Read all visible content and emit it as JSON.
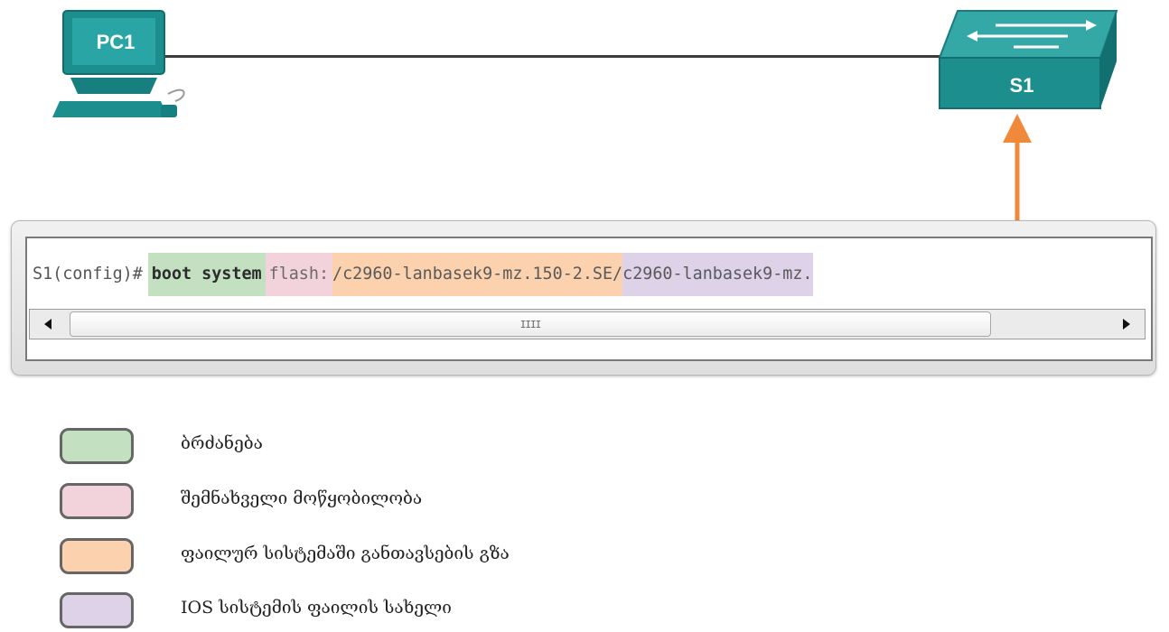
{
  "topology": {
    "pc_label": "PC1",
    "switch_label": "S1"
  },
  "terminal": {
    "prompt": "S1(config)#",
    "command": "boot system",
    "device": "flash:",
    "path": "/c2960-lanbasek9-mz.150-2.SE/",
    "filename": "c2960-lanbasek9-mz.",
    "scroll_thumb_glyph": "IIII"
  },
  "legend": [
    {
      "color": "#c3e0c1",
      "label": "ბრძანება"
    },
    {
      "color": "#f3d3db",
      "label": "შემნახველი მოწყობილობა"
    },
    {
      "color": "#fbd2ad",
      "label": "ფაილურ სისტემაში განთავსების გზა"
    },
    {
      "color": "#ddd2e8",
      "label": "IOS სისტემის ფაილის სახელი"
    }
  ],
  "colors": {
    "device_teal": "#1a8c8c",
    "arrow_orange": "#f08a3a"
  }
}
